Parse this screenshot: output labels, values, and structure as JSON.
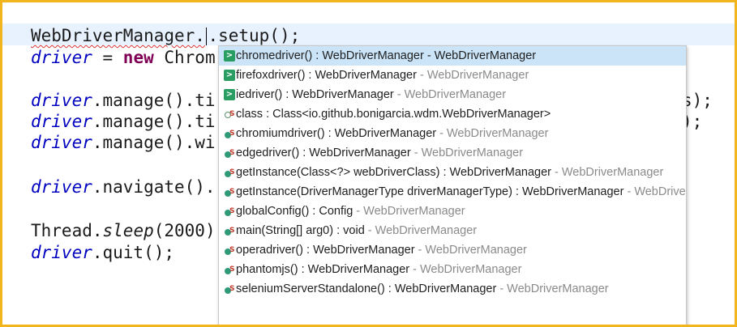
{
  "editor": {
    "lines": [
      {
        "id": "l1",
        "parts": [
          {
            "t": "WebDriverManager.",
            "c": "squiggle"
          },
          {
            "t": "caret"
          },
          {
            "t": ".setup();",
            "c": ""
          }
        ]
      },
      {
        "id": "l2",
        "parts": [
          {
            "t": "driver",
            "c": "var"
          },
          {
            "t": " = ",
            "c": ""
          },
          {
            "t": "new",
            "c": "kw"
          },
          {
            "t": " Chrom",
            "c": ""
          }
        ]
      },
      {
        "id": "l3",
        "parts": [
          {
            "t": "driver",
            "c": "var"
          },
          {
            "t": ".manage().ti",
            "c": ""
          }
        ]
      },
      {
        "id": "l4",
        "parts": [
          {
            "t": "driver",
            "c": "var"
          },
          {
            "t": ".manage().ti",
            "c": ""
          }
        ]
      },
      {
        "id": "l5",
        "parts": [
          {
            "t": "driver",
            "c": "var"
          },
          {
            "t": ".manage().wi",
            "c": ""
          }
        ]
      },
      {
        "id": "l6",
        "parts": [
          {
            "t": "driver",
            "c": "var"
          },
          {
            "t": ".navigate().",
            "c": ""
          }
        ]
      },
      {
        "id": "l7",
        "parts": [
          {
            "t": "Thread.",
            "c": ""
          },
          {
            "t": "sleep",
            "c": "italic"
          },
          {
            "t": "(2000)",
            "c": ""
          }
        ]
      },
      {
        "id": "l8",
        "parts": [
          {
            "t": "driver",
            "c": "var"
          },
          {
            "t": ".quit();",
            "c": ""
          }
        ]
      }
    ],
    "overflow_right": {
      "l3": "s);",
      "l4": ");"
    }
  },
  "autocomplete": {
    "items": [
      {
        "icon": "method-public-icon",
        "sig": "chromedriver() : WebDriverManager",
        "decl": " - WebDriverManager",
        "selected": true
      },
      {
        "icon": "method-public-icon",
        "sig": "firefoxdriver() : WebDriverManager",
        "decl": " - WebDriverManager"
      },
      {
        "icon": "method-public-icon",
        "sig": "iedriver() : WebDriverManager",
        "decl": " - WebDriverManager"
      },
      {
        "icon": "static-field-icon",
        "sig": "class : Class<io.github.bonigarcia.wdm.WebDriverManager>",
        "decl": ""
      },
      {
        "icon": "static-method-icon",
        "sig": "chromiumdriver() : WebDriverManager",
        "decl": " - WebDriverManager"
      },
      {
        "icon": "static-method-icon",
        "sig": "edgedriver() : WebDriverManager",
        "decl": " - WebDriverManager"
      },
      {
        "icon": "static-method-icon",
        "sig": "getInstance(Class<?> webDriverClass) : WebDriverManager",
        "decl": " - WebDriverManager"
      },
      {
        "icon": "static-method-icon",
        "sig": "getInstance(DriverManagerType driverManagerType) : WebDriverManager",
        "decl": " - WebDriverManager"
      },
      {
        "icon": "static-method-icon",
        "sig": "globalConfig() : Config",
        "decl": " - WebDriverManager"
      },
      {
        "icon": "static-method-icon",
        "sig": "main(String[] arg0) : void",
        "decl": " - WebDriverManager"
      },
      {
        "icon": "static-method-icon",
        "sig": "operadriver() : WebDriverManager",
        "decl": " - WebDriverManager"
      },
      {
        "icon": "static-method-icon",
        "sig": "phantomjs() : WebDriverManager",
        "decl": " - WebDriverManager"
      },
      {
        "icon": "static-method-icon",
        "sig": "seleniumServerStandalone() : WebDriverManager",
        "decl": " - WebDriverManager"
      }
    ]
  },
  "colors": {
    "frame_border": "#f2b51e",
    "current_line": "#e8f2fe",
    "selected_item": "#cce4f7",
    "keyword": "#7f0055",
    "variable": "#0000c0"
  }
}
